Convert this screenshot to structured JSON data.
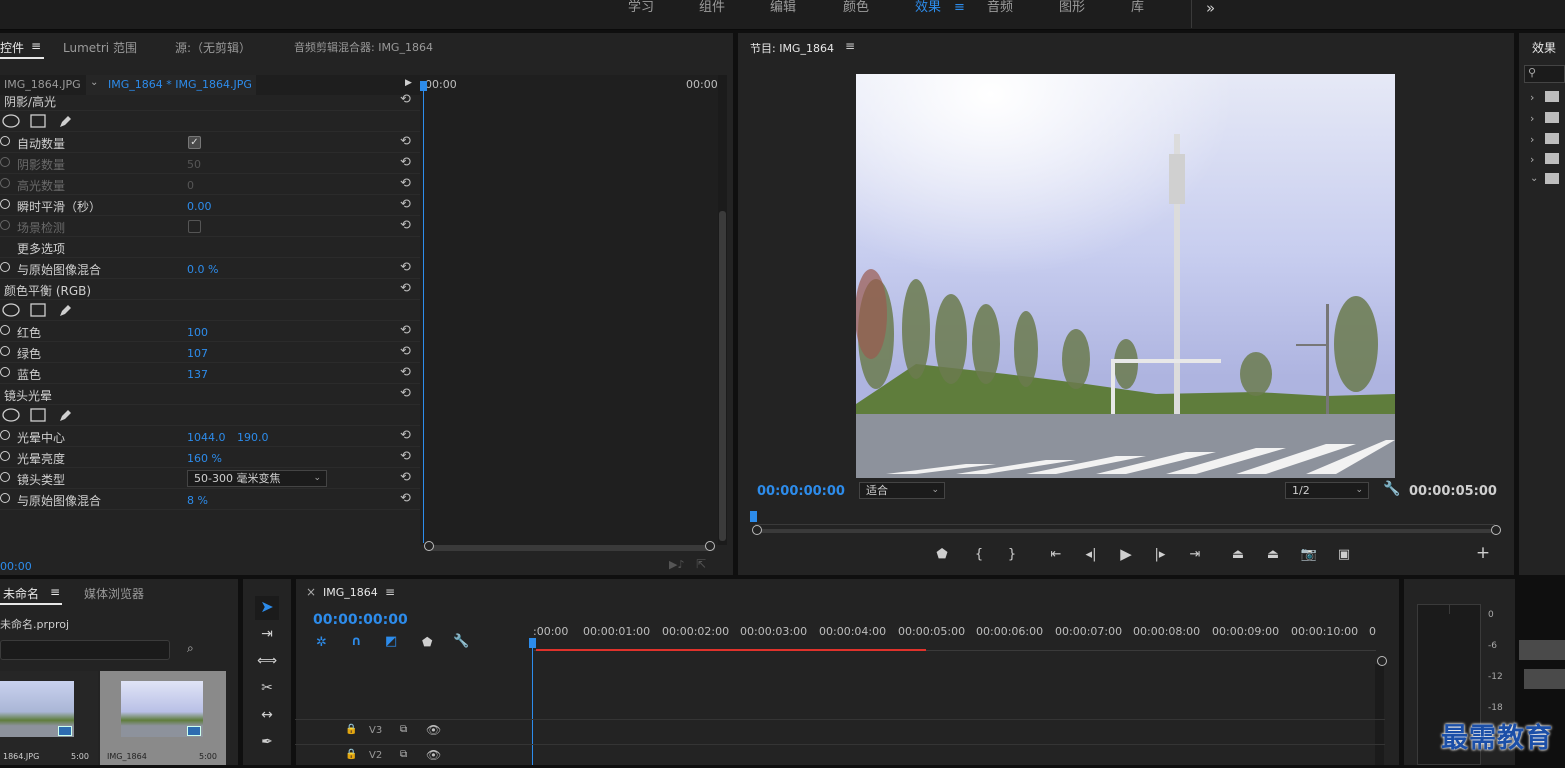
{
  "workspaces": {
    "items": [
      "学习",
      "组件",
      "编辑",
      "颜色",
      "效果",
      "音频",
      "图形",
      "库"
    ],
    "active": "效果",
    "more": "»",
    "menu": "≡"
  },
  "effect_controls": {
    "tabs": {
      "controls": "控件",
      "menu": "≡",
      "lumetri": "Lumetri 范围",
      "source": "源:（无剪辑）",
      "audio_mixer": "音频剪辑混合器: IMG_1864"
    },
    "clip_master": "IMG_1864.JPG",
    "clip_sequence": "IMG_1864 * IMG_1864.JPG",
    "time_start": "00:00",
    "time_end": "00:00",
    "bottom_time": "00:00",
    "rows": {
      "shadow_highlight": "阴影/高光",
      "auto_amount": "自动数量",
      "shadow_amount": "阴影数量",
      "shadow_amount_value": "50",
      "highlight_amount": "高光数量",
      "highlight_amount_value": "0",
      "temporal_smoothing": "瞬时平滑（秒）",
      "temporal_smoothing_value": "0.00",
      "scene_detect": "场景检测",
      "more_options": "更多选项",
      "blend1": "与原始图像混合",
      "blend1_value": "0.0 %",
      "color_balance": "颜色平衡 (RGB)",
      "red": "红色",
      "red_value": "100",
      "green": "绿色",
      "green_value": "107",
      "blue": "蓝色",
      "blue_value": "137",
      "lens_flare": "镜头光晕",
      "flare_center": "光晕中心",
      "flare_center_x": "1044.0",
      "flare_center_y": "190.0",
      "flare_brightness": "光晕亮度",
      "flare_brightness_value": "160 %",
      "lens_type": "镜头类型",
      "lens_type_value": "50-300 毫米变焦",
      "blend2": "与原始图像混合",
      "blend2_value": "8 %"
    }
  },
  "program": {
    "title": "节目: IMG_1864",
    "menu": "≡",
    "timecode": "00:00:00:00",
    "fit": "适合",
    "resolution": "1/2",
    "duration": "00:00:05:00",
    "add": "+"
  },
  "effects_panel": {
    "title": "效果"
  },
  "project": {
    "tab": "未命名",
    "menu": "≡",
    "browser": "媒体浏览器",
    "file": "未命名.prproj",
    "items": [
      {
        "name": "1864.JPG",
        "duration": "5:00"
      },
      {
        "name": "IMG_1864",
        "duration": "5:00"
      }
    ]
  },
  "timeline": {
    "close": "×",
    "seq": "IMG_1864",
    "menu": "≡",
    "timecode": "00:00:00:00",
    "ruler": [
      ":00:00",
      "00:00:01:00",
      "00:00:02:00",
      "00:00:03:00",
      "00:00:04:00",
      "00:00:05:00",
      "00:00:06:00",
      "00:00:07:00",
      "00:00:08:00",
      "00:00:09:00",
      "00:00:10:00",
      "0"
    ],
    "tracks": [
      "V3",
      "V2"
    ]
  },
  "meter": {
    "scale": [
      "0",
      "-6",
      "-12",
      "-18"
    ]
  },
  "watermark": "最需教育",
  "colors": {
    "accent": "#2d8ceb",
    "playhead_range": "#e0322b",
    "panel": "#232323"
  }
}
